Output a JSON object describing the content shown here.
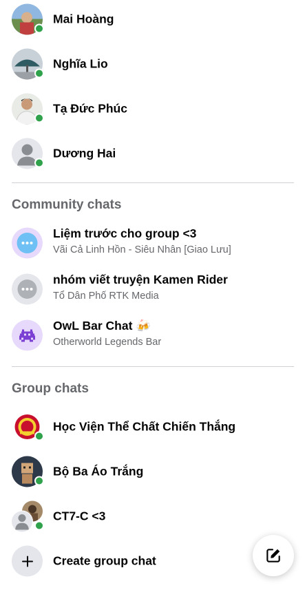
{
  "contacts": [
    {
      "name": "Mai Hoàng",
      "online": true
    },
    {
      "name": "Nghĩa Lio",
      "online": true
    },
    {
      "name": "Tạ Đức Phúc",
      "online": true
    },
    {
      "name": "Dương Hai",
      "online": true
    }
  ],
  "community": {
    "title": "Community chats",
    "items": [
      {
        "name": "Liệm trước cho group <3",
        "sub": "Vãi Cả Linh Hồn - Siêu Nhân [Giao Lưu]"
      },
      {
        "name": "nhóm viết truyện Kamen Rider",
        "sub": "Tổ Dân Phố RTK Media"
      },
      {
        "name": "OwL Bar Chat 🍻",
        "sub": "Otherworld Legends Bar"
      }
    ]
  },
  "groups": {
    "title": "Group chats",
    "items": [
      {
        "name": "Học Viện Thể Chất Chiến Thắng",
        "online": true
      },
      {
        "name": "Bộ Ba Áo Trắng",
        "online": true
      },
      {
        "name": "CT7-C <3",
        "online": true
      }
    ]
  },
  "create": {
    "label": "Create group chat"
  },
  "colors": {
    "online": "#31a24c",
    "muted": "#65676b",
    "accent": "#0866ff"
  }
}
